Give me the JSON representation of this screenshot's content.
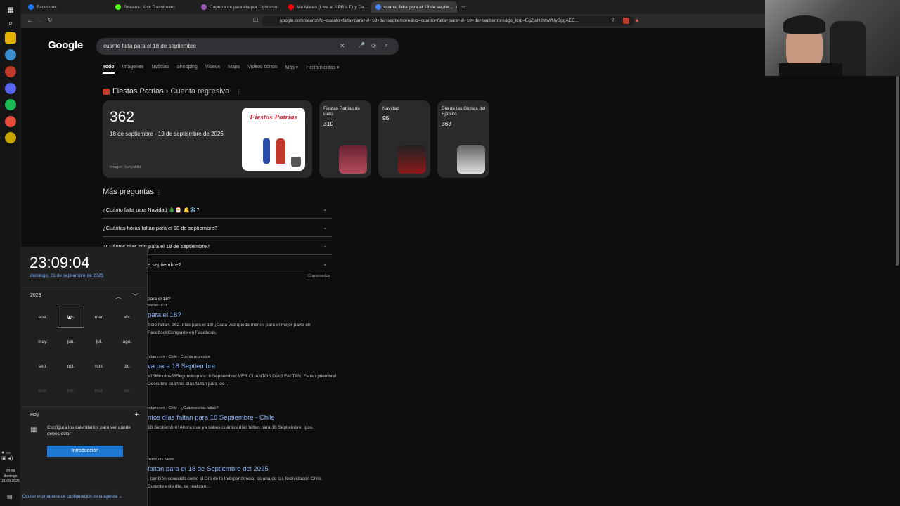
{
  "browser": {
    "tabs": [
      {
        "label": "Facebook",
        "color": "#1877f2"
      },
      {
        "label": "Stream - Kick Dashboard",
        "color": "#53fc18"
      },
      {
        "label": "Captura de pantalla por Lightshot",
        "color": "#9b59b6"
      },
      {
        "label": "Me Maten (Live at NPR's Tiny De...",
        "color": "#ff0000"
      },
      {
        "label": "cuanto falta para el 18 de septie...",
        "color": "#4285f4"
      }
    ],
    "url": "google.com/search?q=cuanto+falta+para+el+18+de+septiembre&oq=cuanto+falta+para+el+18+de+septiembre&gs_lcrp=EgZjaHJvbWUyBggAEE..."
  },
  "google": {
    "logo": "Google",
    "query": "cuanto falta para el 18 de septiembre",
    "nav": [
      "Todo",
      "Imágenes",
      "Noticias",
      "Shopping",
      "Videos",
      "Maps",
      "Videos cortos",
      "Más ▾",
      "Herramientas ▾"
    ],
    "kp_title": "Fiestas Patrias",
    "kp_sub": " › Cuenta regresiva",
    "main_count": "362",
    "main_range": "18 de septiembre - 19 de septiembre de 2026",
    "img_credit": "Imagen: kanyakits",
    "img_text": "Fiestas Patrias",
    "side_cards": [
      {
        "name": "Fiestas Patrias de Perú",
        "value": "310"
      },
      {
        "name": "Navidad",
        "value": "95"
      },
      {
        "name": "Día de las Glorias del Ejército",
        "value": "363"
      }
    ],
    "more_q_title": "Más preguntas",
    "questions": [
      "¿Cuánto falta para Navidad 🎄🎅 🔔❄️?",
      "¿Cuántas horas faltan para el 18 de septiembre?",
      "¿Cuántos días son para el 18 de septiembre?",
      "e septiembre?"
    ],
    "comments": "Comentarios",
    "results": [
      {
        "top": "para el 18?",
        "src": "paraeI18.cl",
        "title": "para el 18?",
        "snip": "Sólo faltan. 362. días para el 18! ¡Cada vez queda menos para el mejor parte en FacebookComparte en Facebook."
      },
      {
        "src": "ndarr.com › Chile › Cuenta regresiva",
        "title": "va para 18 Septiembre",
        "snip": "s15Minutos56Segundospara18 Septiembre! VER CUÁNTOS DÍAS FALTAN. Faltan ptiembre! Descubre cuántos días faltan para los ..."
      },
      {
        "src": "ndarr.com › Chile › ¿Cuántos días faltan?",
        "title": "ntos días faltan para 18 Septiembre - Chile",
        "snip": "18 Septiembre! Ahora que ya sabes cuántos días faltan para 18 Septiembre, igos."
      },
      {
        "src": "rillero.cl › News",
        "title": "faltan para el 18 de Septiembre del 2025",
        "snip": ", también conocido como el Día de la Independencia, es una de las festividades Chile. Durante este día, se realizan ..."
      }
    ]
  },
  "flyout": {
    "time": "23:09:04",
    "date": "domingo, 21 de septiembre de 2025",
    "year": "2028",
    "months": [
      "ene.",
      "feb.",
      "mar.",
      "abr.",
      "may.",
      "jun.",
      "jul.",
      "ago.",
      "sep.",
      "oct.",
      "nov.",
      "dic."
    ],
    "months_next": [
      "ene.",
      "feb.",
      "mar.",
      "abr."
    ],
    "today_label": "Hoy",
    "config_text": "Configura los calendarios para ver dónde debes estar",
    "intro_button": "Introducción",
    "hide_agenda": "Ocultar el programa de configuración de la agenda"
  },
  "tray": {
    "time": "23:09",
    "day": "domingo",
    "date": "21-09-2025"
  }
}
